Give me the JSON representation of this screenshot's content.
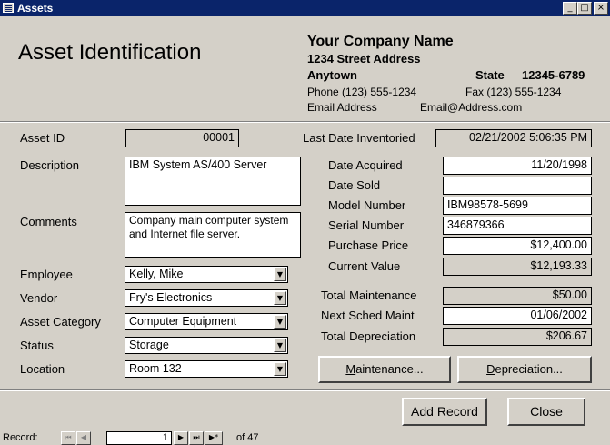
{
  "window": {
    "title": "Assets"
  },
  "header": {
    "form_title": "Asset Identification",
    "company_name": "Your Company Name",
    "street": "1234 Street Address",
    "city": "Anytown",
    "state": "State",
    "zip": "12345-6789",
    "phone": "Phone  (123) 555-1234",
    "fax": "Fax  (123) 555-1234",
    "email_label": "Email Address",
    "email": "Email@Address.com"
  },
  "fields": {
    "asset_id": {
      "label": "Asset ID",
      "value": "00001"
    },
    "last_inventoried": {
      "label": "Last Date Inventoried",
      "value": "02/21/2002 5:06:35 PM"
    },
    "description": {
      "label": "Description",
      "value": "IBM System AS/400 Server"
    },
    "comments": {
      "label": "Comments",
      "value": "Company main computer system and Internet file server."
    },
    "employee": {
      "label": "Employee",
      "value": "Kelly, Mike"
    },
    "vendor": {
      "label": "Vendor",
      "value": "Fry's Electronics"
    },
    "asset_category": {
      "label": "Asset Category",
      "value": "Computer Equipment"
    },
    "status": {
      "label": "Status",
      "value": "Storage"
    },
    "location": {
      "label": "Location",
      "value": "Room 132"
    },
    "date_acquired": {
      "label": "Date Acquired",
      "value": "11/20/1998"
    },
    "date_sold": {
      "label": "Date Sold",
      "value": ""
    },
    "model_number": {
      "label": "Model Number",
      "value": "IBM98578-5699"
    },
    "serial_number": {
      "label": "Serial Number",
      "value": "346879366"
    },
    "purchase_price": {
      "label": "Purchase Price",
      "value": "$12,400.00"
    },
    "current_value": {
      "label": "Current Value",
      "value": "$12,193.33"
    },
    "total_maintenance": {
      "label": "Total Maintenance",
      "value": "$50.00"
    },
    "next_sched_maint": {
      "label": "Next Sched Maint",
      "value": "01/06/2002"
    },
    "total_depreciation": {
      "label": "Total Depreciation",
      "value": "$206.67"
    }
  },
  "buttons": {
    "maintenance": {
      "underline": "M",
      "rest": "aintenance..."
    },
    "depreciation": {
      "underline": "D",
      "rest": "epreciation..."
    },
    "add_record": "Add Record",
    "close": "Close"
  },
  "navigator": {
    "label": "Record:",
    "first": "⏮",
    "prev": "◀",
    "next": "▶",
    "last": "⏭",
    "new": "▶*",
    "current": "1",
    "of_text": "of  47"
  },
  "icons": [
    "form-icon",
    "minimize-icon",
    "maximize-icon",
    "close-icon",
    "dropdown-arrow-icon"
  ]
}
